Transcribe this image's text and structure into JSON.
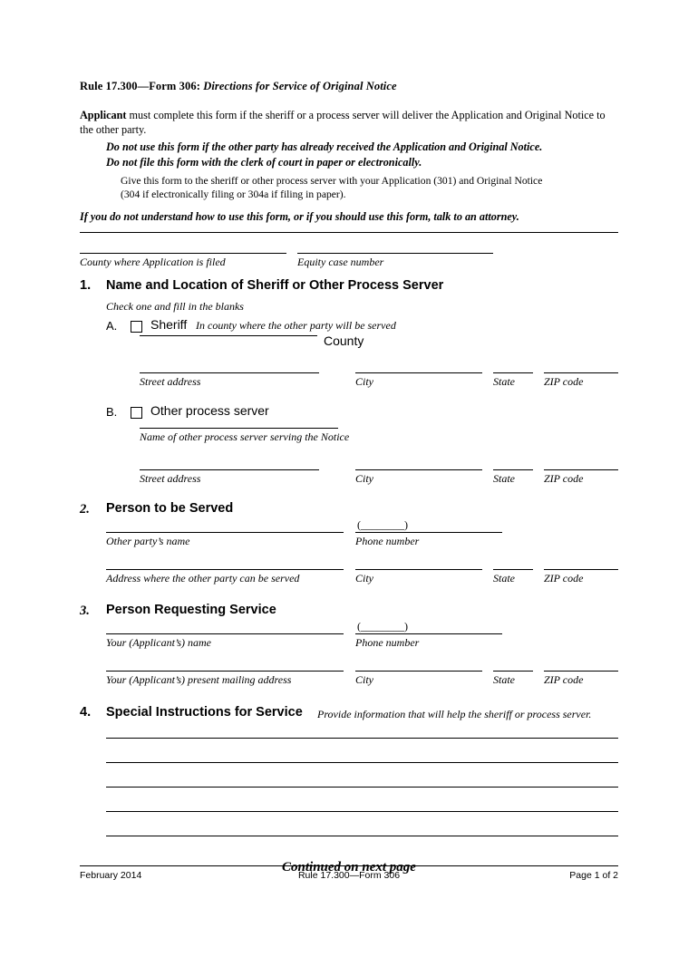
{
  "document": {
    "title_prefix": "Rule 17.300—Form 306:",
    "title_suffix": "Directions for Service of Original Notice",
    "applicant_label": "Applicant",
    "applicant_text": " must complete this form if the sheriff or a process server will deliver the Application and Original Notice to the other party.",
    "warning_1": "Do not use this form if the other party has already received the Application and Original Notice.",
    "warning_2": "Do not file this form with the clerk of court in paper or electronically.",
    "instruction_1": "Give this form to the sheriff or other process server with your Application (301) and Original Notice",
    "instruction_2": "(304 if electronically filing or 304a if filing in paper).",
    "attorney_note": "If you do not understand how to use this form, or if you should use this form, talk to an attorney."
  },
  "header_fields": {
    "county_caption": "County where Application is filed",
    "case_caption": "Equity case number",
    "county_value": "",
    "case_value": ""
  },
  "section1": {
    "number": "1.",
    "title": "Name and Location of Sheriff or Other Process Server",
    "subnote": "Check one and fill in the blanks",
    "option_a_letter": "A.",
    "option_a_label": "Sheriff",
    "option_a_note": "In county where the other party will be served",
    "county_word": "County",
    "option_b_letter": "B.",
    "option_b_label": "Other process server",
    "server_name_caption": "Name of other process server serving the Notice",
    "address_caption": "Street address",
    "city_caption": "City",
    "state_caption": "State",
    "zip_caption": "ZIP code",
    "values": {
      "a_county": "",
      "a_street": "",
      "a_city": "",
      "a_state": "",
      "a_zip": "",
      "b_server_name": "",
      "b_street": "",
      "b_city": "",
      "b_state": "",
      "b_zip": ""
    }
  },
  "section2": {
    "number": "2.",
    "title": "Person to be Served",
    "name_caption": "Other party’s name",
    "phone_caption": "Phone number",
    "phone_prefix": "(",
    "phone_suffix": ")",
    "address_caption": "Address where the other party can be served",
    "city_caption": "City",
    "state_caption": "State",
    "zip_caption": "ZIP code",
    "values": {
      "name": "",
      "phone": "",
      "address": "",
      "city": "",
      "state": "",
      "zip": ""
    }
  },
  "section3": {
    "number": "3.",
    "title": "Person Requesting Service",
    "name_caption": "Your (Applicant’s) name",
    "phone_caption": "Phone number",
    "phone_prefix": "(",
    "phone_suffix": ")",
    "address_caption": "Your (Applicant’s) present mailing address",
    "city_caption": "City",
    "state_caption": "State",
    "zip_caption": "ZIP code",
    "values": {
      "name": "",
      "phone": "",
      "address": "",
      "city": "",
      "state": "",
      "zip": ""
    }
  },
  "section4": {
    "number": "4.",
    "title": "Special Instructions for Service",
    "note": "Provide information that will help the sheriff or process server.",
    "lines": [
      "",
      "",
      "",
      "",
      ""
    ]
  },
  "continued": "Continued on next page",
  "footer": {
    "left": "February 2014",
    "center": "Rule 17.300—Form 306",
    "right": "Page 1 of 2"
  }
}
